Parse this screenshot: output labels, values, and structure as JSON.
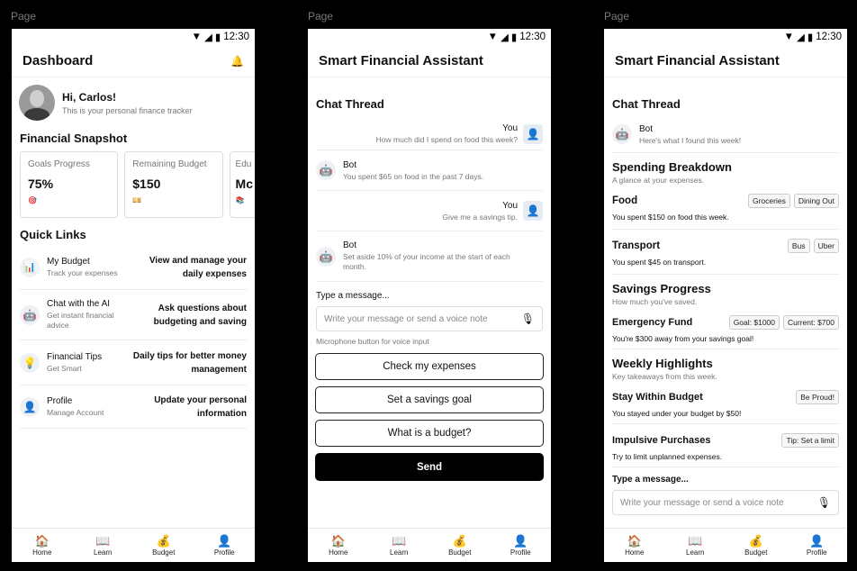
{
  "status": {
    "time": "12:30"
  },
  "page_label": "Page",
  "nav": [
    {
      "icon": "🏠",
      "label": "Home"
    },
    {
      "icon": "📖",
      "label": "Learn"
    },
    {
      "icon": "💰",
      "label": "Budget"
    },
    {
      "icon": "👤",
      "label": "Profile"
    }
  ],
  "screen1": {
    "title": "Dashboard",
    "bell": "🔔",
    "greeting": "Hi, Carlos!",
    "greeting_sub": "This is your personal finance tracker",
    "snapshot_title": "Financial Snapshot",
    "cards": [
      {
        "label": "Goals Progress",
        "value": "75%",
        "icon": "🎯"
      },
      {
        "label": "Remaining Budget",
        "value": "$150",
        "icon": "💴"
      },
      {
        "label": "Edu",
        "value": "Mc",
        "icon": "📚"
      }
    ],
    "quick_links_title": "Quick Links",
    "links": [
      {
        "icon": "📊",
        "title": "My Budget",
        "sub": "Track your expenses",
        "desc": "View and manage your daily expenses"
      },
      {
        "icon": "🤖",
        "title": "Chat with the AI",
        "sub": "Get instant financial advice",
        "desc": "Ask questions about budgeting and saving"
      },
      {
        "icon": "💡",
        "title": "Financial Tips",
        "sub": "Get Smart",
        "desc": "Daily tips for better money management"
      },
      {
        "icon": "👤",
        "title": "Profile",
        "sub": "Manage Account",
        "desc": "Update your personal information"
      }
    ]
  },
  "screen2": {
    "title": "Smart Financial Assistant",
    "thread_title": "Chat Thread",
    "messages": [
      {
        "from": "You",
        "text": "How much did I spend on food this week?"
      },
      {
        "from": "Bot",
        "text": "You spent $65 on food in the past 7 days."
      },
      {
        "from": "You",
        "text": "Give me a savings tip."
      },
      {
        "from": "Bot",
        "text": "Set aside 10% of your income at the start of each month."
      }
    ],
    "type_label": "Type a message...",
    "input_placeholder": "Write your message or send a voice note",
    "mic_hint": "Microphone button for voice input",
    "quick_buttons": [
      "Check my expenses",
      "Set a savings goal",
      "What is a budget?"
    ],
    "send_label": "Send"
  },
  "screen3": {
    "title": "Smart Financial Assistant",
    "thread_title": "Chat Thread",
    "bot_name": "Bot",
    "bot_text": "Here's what I found this week!",
    "breakdown_title": "Spending Breakdown",
    "breakdown_sub": "A glance at your expenses.",
    "food": {
      "title": "Food",
      "chips": [
        "Groceries",
        "Dining Out"
      ],
      "text": "You spent $150 on food this week."
    },
    "transport": {
      "title": "Transport",
      "chips": [
        "Bus",
        "Uber"
      ],
      "text": "You spent $45 on transport."
    },
    "savings_title": "Savings Progress",
    "savings_sub": "How much you've saved.",
    "fund": {
      "title": "Emergency Fund",
      "chips": [
        "Goal: $1000",
        "Current: $700"
      ],
      "text": "You're $300 away from your savings goal!"
    },
    "weekly_title": "Weekly Highlights",
    "weekly_sub": "Key takeaways from this week.",
    "within": {
      "title": "Stay Within Budget",
      "chips": [
        "Be Proud!"
      ],
      "text": "You stayed under your budget by $50!"
    },
    "impulse": {
      "title": "Impulsive Purchases",
      "chips": [
        "Tip: Set a limit"
      ],
      "text": "Try to limit unplanned expenses."
    },
    "type_label": "Type a message...",
    "input_placeholder": "Write your message or send a voice note"
  }
}
